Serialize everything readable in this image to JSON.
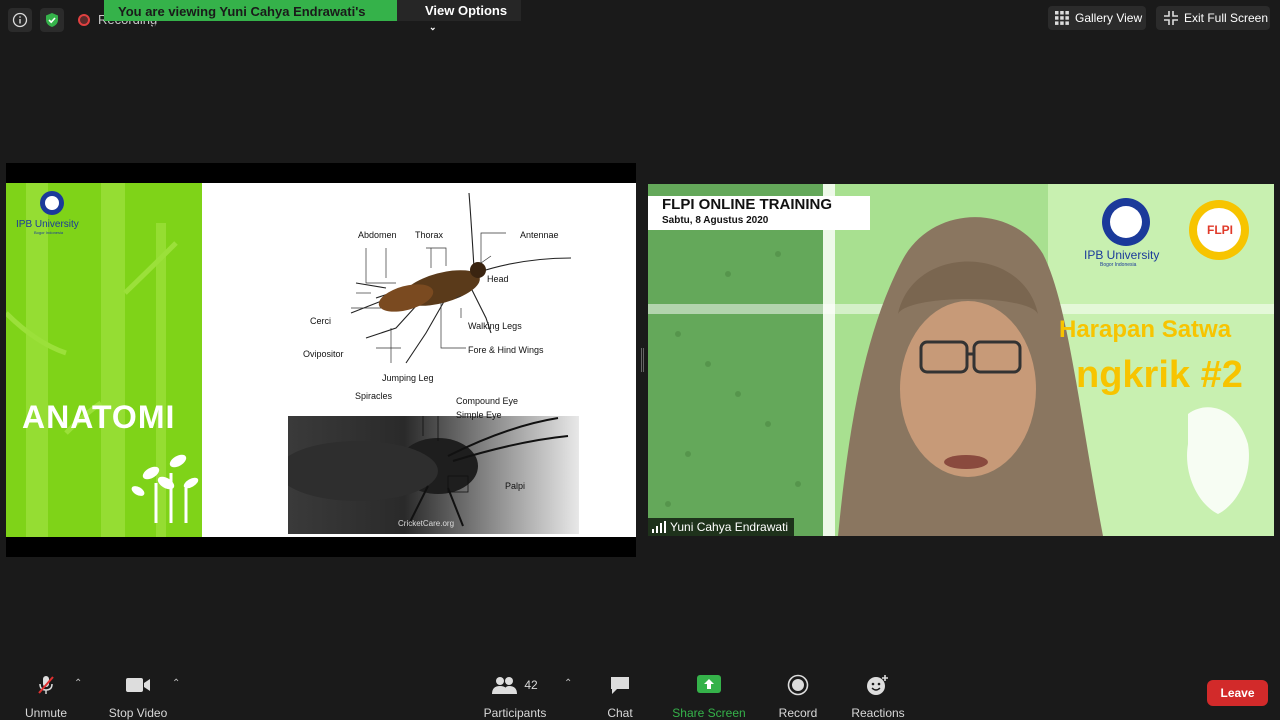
{
  "topbar": {
    "recording_text": "Recording",
    "share_banner": "You are viewing Yuni Cahya Endrawati's screen",
    "view_options": "View Options",
    "gallery_view": "Gallery View",
    "exit_full_screen": "Exit Full Screen"
  },
  "slide": {
    "title": "ANATOMI",
    "logo_text": "IPB University",
    "logo_sub": "Bogor Indonesia",
    "labels": {
      "abdomen": "Abdomen",
      "thorax": "Thorax",
      "antennae": "Antennae",
      "head": "Head",
      "cerci": "Cerci",
      "ovipositor": "Ovipositor",
      "walking_legs": "Walking Legs",
      "fore_hind_wings": "Fore & Hind Wings",
      "jumping_leg": "Jumping Leg",
      "spiracles": "Spiracles",
      "compound_eye": "Compound Eye",
      "simple_eye": "Simple Eye",
      "palpi": "Palpi"
    },
    "photo_credit": "CricketCare.org"
  },
  "video": {
    "banner_title": "FLPI ONLINE TRAINING",
    "banner_date": "Sabtu, 8 Agustus 2020",
    "logo_text": "IPB University",
    "logo_sub": "Bogor Indonesia",
    "flpi_logo": "FLPI",
    "headline1": "Harapan Satwa",
    "headline2": "ngkrik #2",
    "participant_name": "Yuni Cahya Endrawati"
  },
  "toolbar": {
    "unmute": "Unmute",
    "stop_video": "Stop Video",
    "participants": "Participants",
    "participants_count": "42",
    "chat": "Chat",
    "share_screen": "Share Screen",
    "record": "Record",
    "reactions": "Reactions",
    "leave": "Leave"
  },
  "colors": {
    "share_green": "#35b24a",
    "leave_red": "#d22a2a",
    "slide_green": "#7fd318"
  }
}
